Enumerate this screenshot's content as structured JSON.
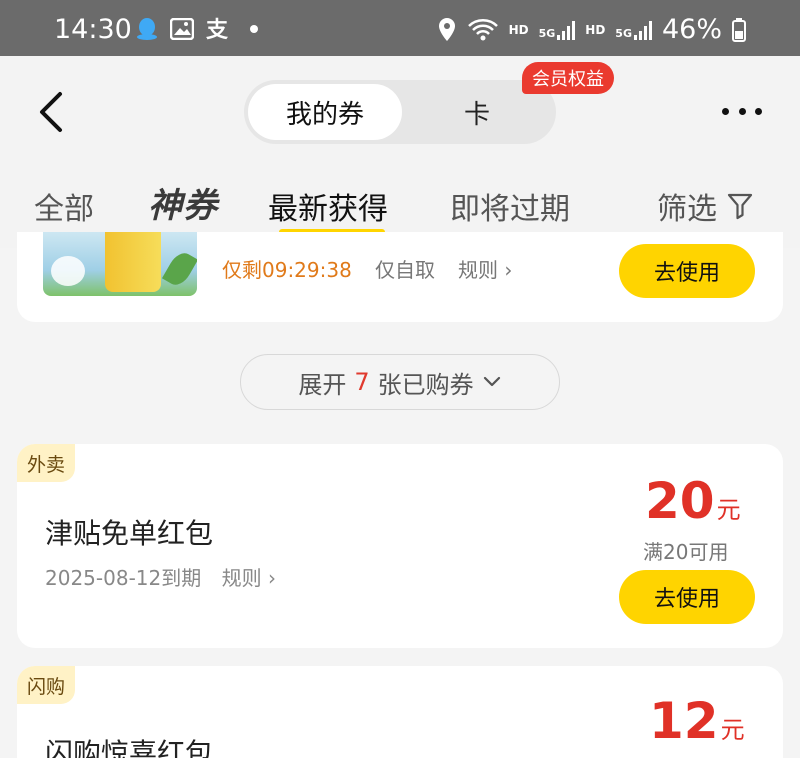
{
  "status_bar": {
    "time": "14:30",
    "hd1": "HD",
    "net1": "5G",
    "hd2": "HD",
    "net2": "5G",
    "battery": "46%",
    "icons": [
      "qq-icon",
      "gallery-icon",
      "alipay-icon",
      "dot-icon",
      "location-icon",
      "wifi-icon",
      "signal-icon",
      "battery-icon"
    ]
  },
  "header": {
    "segments": {
      "active": "我的券",
      "other": "卡"
    },
    "vip_badge": "会员权益"
  },
  "tabs": {
    "all": "全部",
    "shen": "神券",
    "newest": "最新获得",
    "expiring": "即将过期",
    "filter": "筛选"
  },
  "top_card": {
    "countdown": "仅剩09:29:38",
    "pickup": "仅自取",
    "rule": "规则 ›",
    "use_button": "去使用"
  },
  "expand": {
    "prefix": "展开",
    "count": "7",
    "suffix": "张已购券"
  },
  "coupons": [
    {
      "tag": "外卖",
      "title": "津贴免单红包",
      "expiry": "2025-08-12到期",
      "rule": "规则 ›",
      "amount": "20",
      "unit": "元",
      "condition": "满20可用",
      "use_button": "去使用"
    },
    {
      "tag": "闪购",
      "title": "闪购惊喜红包",
      "amount": "12",
      "unit": "元"
    }
  ],
  "colors": {
    "accent_yellow": "#ffd400",
    "price_red": "#e03127",
    "countdown_orange": "#e07a1a",
    "badge_red": "#ea3a2f"
  }
}
